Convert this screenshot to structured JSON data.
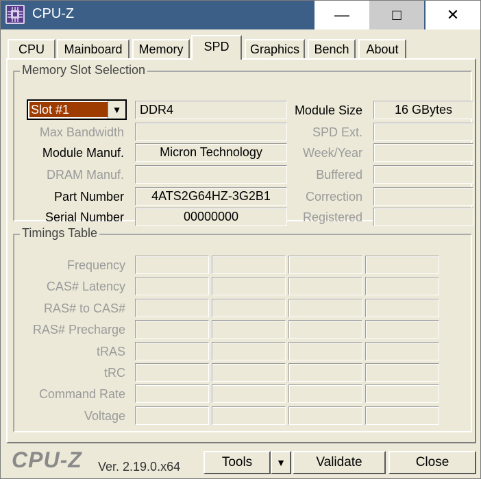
{
  "window": {
    "title": "CPU-Z",
    "minimize_glyph": "—",
    "maximize_glyph": "□",
    "close_glyph": "✕"
  },
  "tabs": [
    {
      "label": "CPU"
    },
    {
      "label": "Mainboard"
    },
    {
      "label": "Memory"
    },
    {
      "label": "SPD",
      "active": true
    },
    {
      "label": "Graphics"
    },
    {
      "label": "Bench"
    },
    {
      "label": "About"
    }
  ],
  "slot_section": {
    "title": "Memory Slot Selection",
    "slot_value": "Slot #1",
    "memory_type": "DDR4",
    "left_labels": {
      "max_bandwidth": "Max Bandwidth",
      "module_manuf": "Module Manuf.",
      "dram_manuf": "DRAM Manuf.",
      "part_number": "Part Number",
      "serial_number": "Serial Number"
    },
    "left_values": {
      "max_bandwidth": "",
      "module_manuf": "Micron Technology",
      "dram_manuf": "",
      "part_number": "4ATS2G64HZ-3G2B1",
      "serial_number": "00000000"
    },
    "right_labels": {
      "module_size": "Module Size",
      "spd_ext": "SPD Ext.",
      "week_year": "Week/Year",
      "buffered": "Buffered",
      "correction": "Correction",
      "registered": "Registered"
    },
    "right_values": {
      "module_size": "16 GBytes",
      "spd_ext": "",
      "week_year": "",
      "buffered": "",
      "correction": "",
      "registered": ""
    }
  },
  "timings": {
    "title": "Timings Table",
    "rows": [
      "Frequency",
      "CAS# Latency",
      "RAS# to CAS#",
      "RAS# Precharge",
      "tRAS",
      "tRC",
      "Command Rate",
      "Voltage"
    ]
  },
  "footer": {
    "logo": "CPU-Z",
    "version": "Ver. 2.19.0.x64",
    "tools_label": "Tools",
    "validate_label": "Validate",
    "close_label": "Close"
  }
}
